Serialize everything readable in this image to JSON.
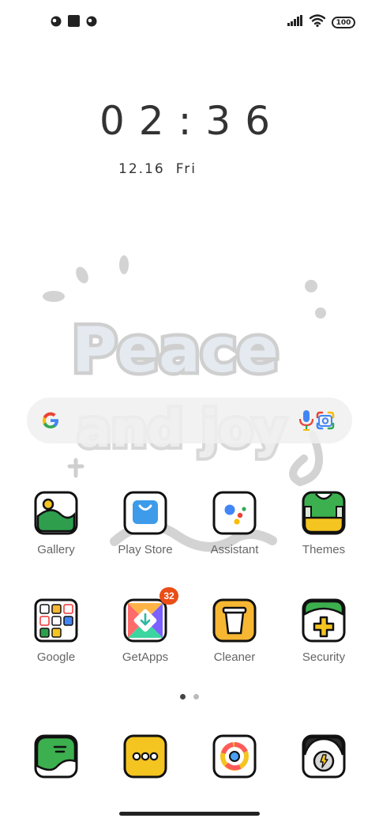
{
  "status_bar": {
    "left_icons": [
      "notification-icon-1",
      "notification-icon-2",
      "notification-icon-3"
    ],
    "right_icons": [
      "signal-icon",
      "wifi-icon",
      "battery-icon"
    ],
    "battery": "100"
  },
  "clock": {
    "time": "02:36",
    "date_month": "12",
    "date_day": "16",
    "weekday": "Fri"
  },
  "wallpaper": {
    "line1": "Peace",
    "line2": "and joy"
  },
  "search": {
    "icons": [
      "google-g-icon",
      "microphone-icon",
      "google-lens-icon"
    ]
  },
  "apps": [
    {
      "label": "Gallery"
    },
    {
      "label": "Play Store"
    },
    {
      "label": "Assistant"
    },
    {
      "label": "Themes"
    },
    {
      "label": "Google"
    },
    {
      "label": "GetApps",
      "badge": "32"
    },
    {
      "label": "Cleaner"
    },
    {
      "label": "Security"
    }
  ],
  "dock": [
    {
      "icon": "messages-icon"
    },
    {
      "icon": "more-apps-icon"
    },
    {
      "icon": "browser-icon"
    },
    {
      "icon": "camera-icon"
    }
  ],
  "pages": {
    "count": 2,
    "active": 1
  }
}
